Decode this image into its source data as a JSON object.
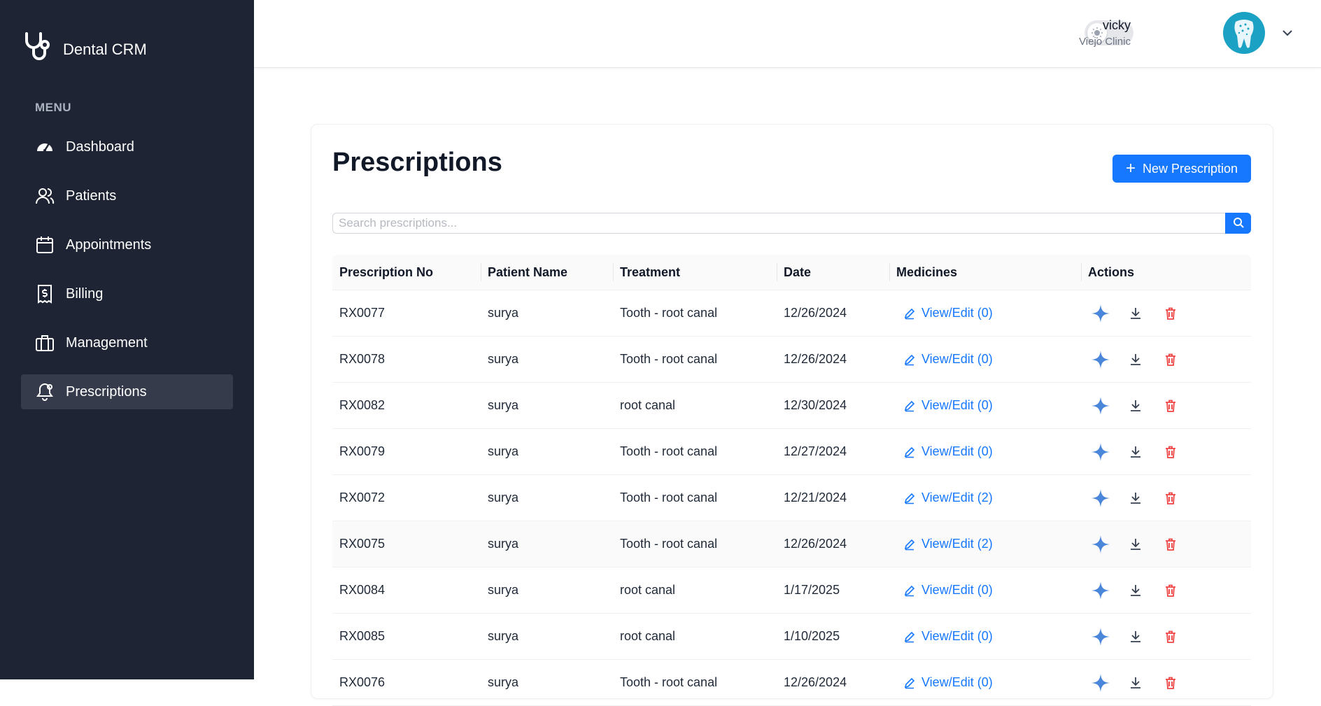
{
  "app": {
    "name": "Dental CRM"
  },
  "sidebar": {
    "menu_label": "MENU",
    "items": [
      {
        "label": "Dashboard",
        "icon": "dashboard-gauge-icon"
      },
      {
        "label": "Patients",
        "icon": "users-icon"
      },
      {
        "label": "Appointments",
        "icon": "calendar-icon"
      },
      {
        "label": "Billing",
        "icon": "receipt-dollar-icon"
      },
      {
        "label": "Management",
        "icon": "briefcase-icon"
      },
      {
        "label": "Prescriptions",
        "icon": "bell-icon",
        "active": true
      }
    ]
  },
  "header": {
    "user_name": "vicky",
    "clinic": "Viejo Clinic",
    "theme_toggle_icon": "sun-icon"
  },
  "page": {
    "title": "Prescriptions",
    "new_button": "New Prescription",
    "search_placeholder": "Search prescriptions..."
  },
  "table": {
    "columns": [
      "Prescription No",
      "Patient Name",
      "Treatment",
      "Date",
      "Medicines",
      "Actions"
    ],
    "rows": [
      {
        "no": "RX0077",
        "patient": "surya",
        "treatment": "Tooth - root canal",
        "date": "12/26/2024",
        "medicines": "View/Edit (0)"
      },
      {
        "no": "RX0078",
        "patient": "surya",
        "treatment": "Tooth - root canal",
        "date": "12/26/2024",
        "medicines": "View/Edit (0)"
      },
      {
        "no": "RX0082",
        "patient": "surya",
        "treatment": "root canal",
        "date": "12/30/2024",
        "medicines": "View/Edit (0)"
      },
      {
        "no": "RX0079",
        "patient": "surya",
        "treatment": "Tooth - root canal",
        "date": "12/27/2024",
        "medicines": "View/Edit (0)"
      },
      {
        "no": "RX0072",
        "patient": "surya",
        "treatment": "Tooth - root canal",
        "date": "12/21/2024",
        "medicines": "View/Edit (2)"
      },
      {
        "no": "RX0075",
        "patient": "surya",
        "treatment": "Tooth - root canal",
        "date": "12/26/2024",
        "medicines": "View/Edit (2)",
        "highlighted": true
      },
      {
        "no": "RX0084",
        "patient": "surya",
        "treatment": "root canal",
        "date": "1/17/2025",
        "medicines": "View/Edit (0)"
      },
      {
        "no": "RX0085",
        "patient": "surya",
        "treatment": "root canal",
        "date": "1/10/2025",
        "medicines": "View/Edit (0)"
      },
      {
        "no": "RX0076",
        "patient": "surya",
        "treatment": "Tooth - root canal",
        "date": "12/26/2024",
        "medicines": "View/Edit (0)"
      }
    ]
  },
  "colors": {
    "sidebar_bg": "#1e2433",
    "sidebar_active": "#353b4a",
    "primary": "#1677ff",
    "delete": "#ef4444",
    "sparkle": "#4a86d9"
  }
}
